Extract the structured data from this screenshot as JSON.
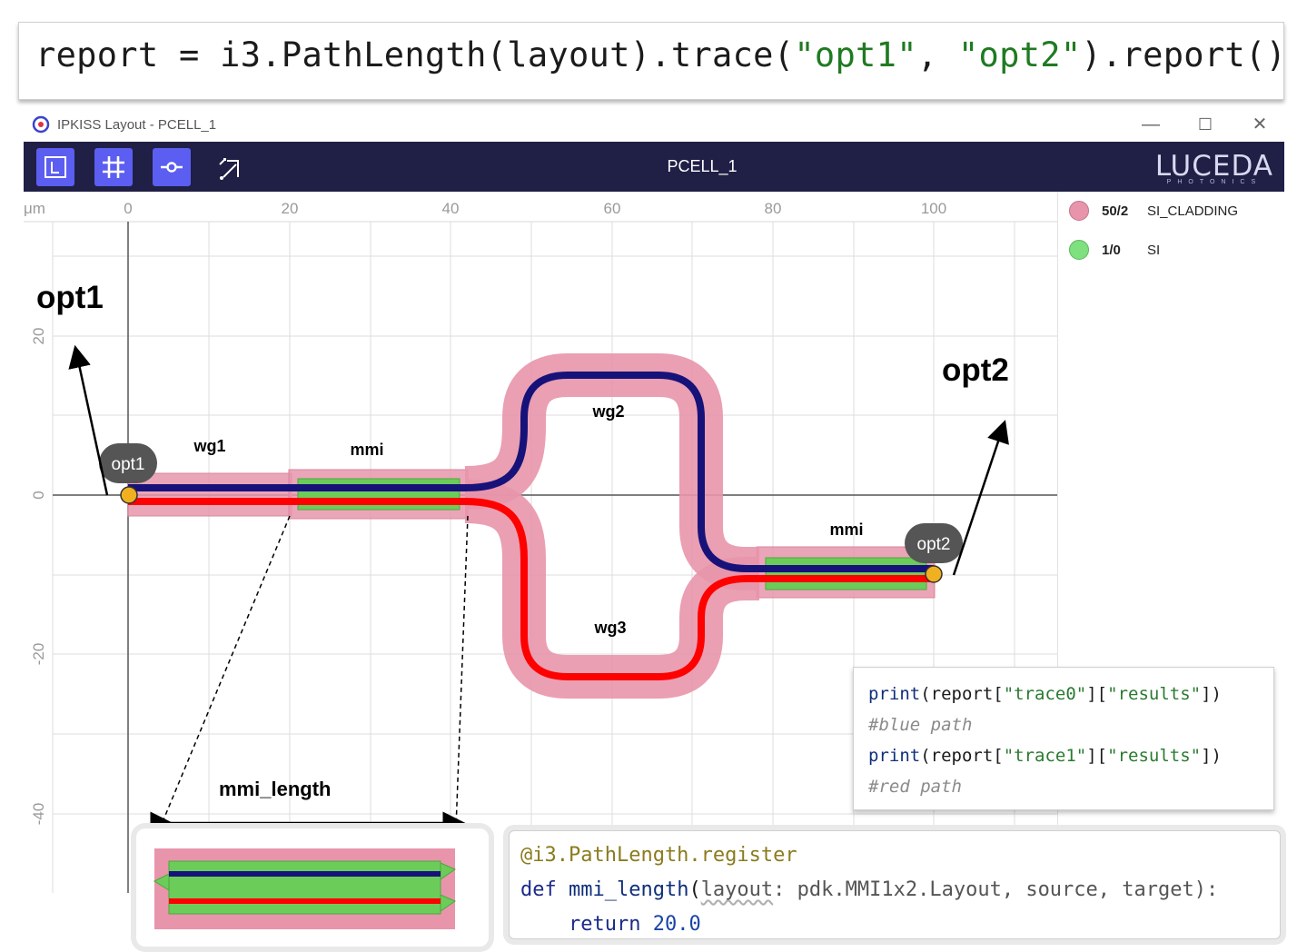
{
  "top_code": {
    "prefix": "report = i3.PathLength(layout).trace(",
    "arg1": "\"opt1\"",
    "comma": ", ",
    "arg2": "\"opt2\"",
    "suffix": ").report()"
  },
  "window": {
    "title": "IPKISS Layout - PCELL_1",
    "minimize": "—",
    "maximize": "☐",
    "close": "✕"
  },
  "toolbar": {
    "cell_title": "PCELL_1",
    "logo_text": "LUCEDA",
    "logo_sub": "PHOTONICS"
  },
  "axes": {
    "unit": "μm",
    "x_ticks": [
      "0",
      "20",
      "40",
      "60",
      "80",
      "100"
    ],
    "y_ticks": [
      "20",
      "0",
      "-20",
      "-40"
    ]
  },
  "legend": [
    {
      "num": "50/2",
      "name": "SI_CLADDING",
      "color": "#e895ab"
    },
    {
      "num": "1/0",
      "name": "SI",
      "color": "#7ee07e"
    }
  ],
  "annotations": {
    "opt1_big": "opt1",
    "opt2_big": "opt2",
    "opt1_bubble": "opt1",
    "opt2_bubble": "opt2",
    "wg1": "wg1",
    "wg2": "wg2",
    "wg3": "wg3",
    "mmi_left": "mmi",
    "mmi_right": "mmi",
    "mmi_length": "mmi_length"
  },
  "print_code": {
    "line1_fn": "print",
    "line1_a": "(report[",
    "line1_s1": "\"trace0\"",
    "line1_b": "][",
    "line1_s2": "\"results\"",
    "line1_c": "])",
    "comment1": "#blue path",
    "line2_fn": "print",
    "line2_a": "(report[",
    "line2_s1": "\"trace1\"",
    "line2_b": "][",
    "line2_s2": "\"results\"",
    "line2_c": "])",
    "comment2": "#red path"
  },
  "register_code": {
    "decorator": "@i3.PathLength.register",
    "def_kw": "def ",
    "fn_name": "mmi_length",
    "open": "(",
    "p_layout": "layout",
    "sig_rest": ": pdk.MMI1x2.Layout, source, target):",
    "return_kw": "return ",
    "return_val": "20.0"
  },
  "colors": {
    "cladding": "#e895ab",
    "si": "#6ccc5a",
    "blue_path": "#16127a",
    "red_path": "#ff0000",
    "port": "#f0b020",
    "toolbar_bg": "#201f45",
    "toolbar_btn": "#5b5ef0"
  }
}
